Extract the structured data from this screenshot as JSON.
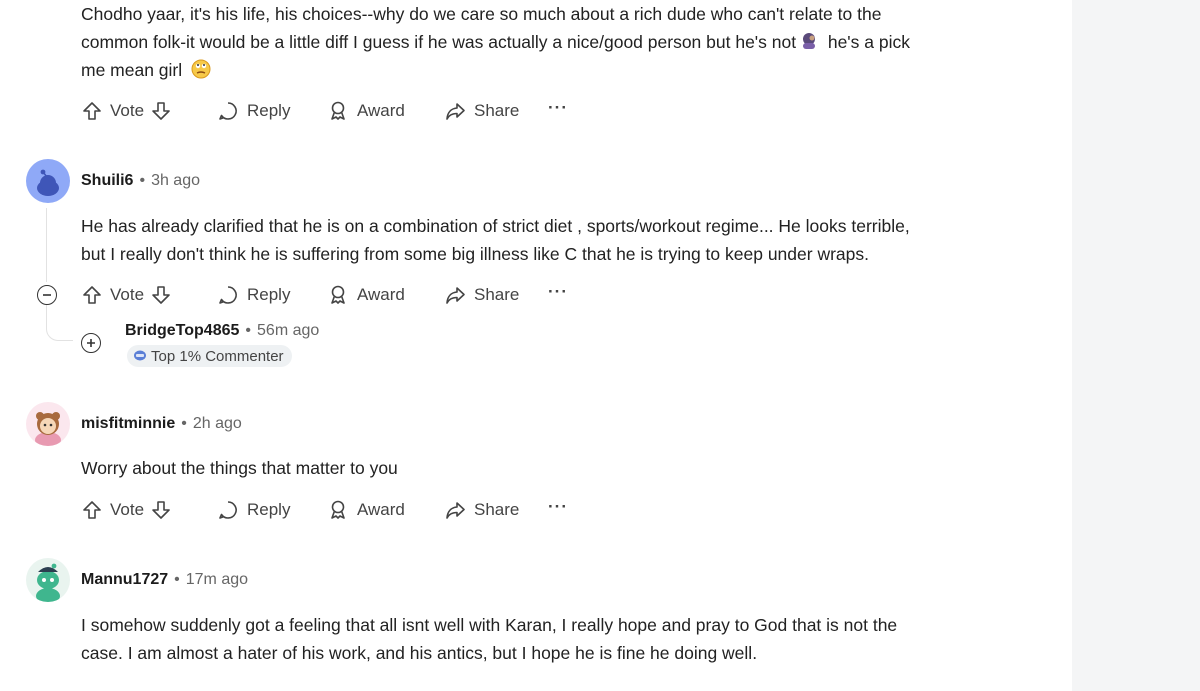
{
  "comments": [
    {
      "text_lines": [
        "Chodho yaar, it's his life, his choices--why do we care so much about a rich dude who can't relate to the",
        "common folk-it would be a little diff I guess if he was actually a nice/good person but he's not",
        "me mean girl"
      ],
      "text_line2_tail": "he's a pick",
      "emoji_1": "facepalm-emoji",
      "emoji_2": "eye-roll-emoji"
    },
    {
      "username": "Shuili6",
      "time": "3h ago",
      "text_lines": [
        "He has already clarified that he is on a combination of strict diet , sports/workout regime... He looks terrible,",
        "but I really don't think he is suffering from some big illness like C that he is trying to keep under wraps."
      ]
    },
    {
      "username": "BridgeTop4865",
      "time": "56m ago",
      "badge": "Top 1% Commenter"
    },
    {
      "username": "misfitminnie",
      "time": "2h ago",
      "text_lines": [
        "Worry about the things that matter to you"
      ]
    },
    {
      "username": "Mannu1727",
      "time": "17m ago",
      "text_lines": [
        "I somehow suddenly got a feeling that all isnt well with Karan, I really hope and pray to God that is not the",
        "case. I am almost a hater of his work, and his antics, but I hope he is fine he doing well."
      ]
    }
  ],
  "actions": {
    "vote": "Vote",
    "reply": "Reply",
    "award": "Award",
    "share": "Share",
    "more": "···"
  },
  "meta_separator": "•",
  "colors": {
    "text": "#1c1c1c",
    "muted": "#666666",
    "avatar_blue": "#8fa9f7",
    "avatar_green": "#3fb68e",
    "side_panel": "#f4f5f6"
  }
}
